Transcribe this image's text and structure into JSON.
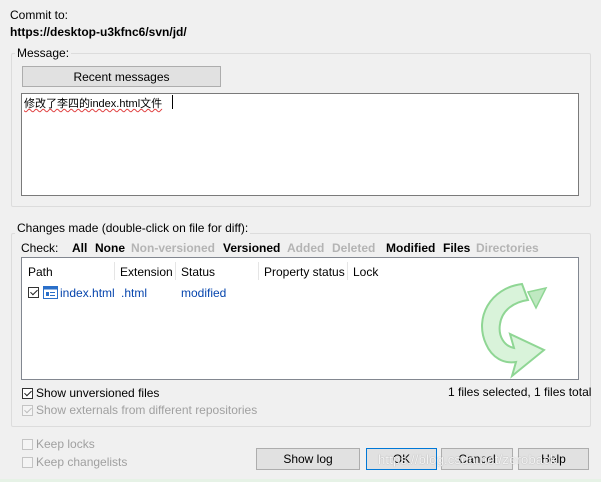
{
  "commit": {
    "label": "Commit to:",
    "url": "https://desktop-u3kfnc6/svn/jd/"
  },
  "message": {
    "group_label": "Message:",
    "recent_button": "Recent messages",
    "text": "修改了李四的index.html文件"
  },
  "changes": {
    "group_label": "Changes made (double-click on file for diff):",
    "check_label": "Check:",
    "filters": [
      {
        "label": "All",
        "enabled": true
      },
      {
        "label": "None",
        "enabled": true
      },
      {
        "label": "Non-versioned",
        "enabled": false
      },
      {
        "label": "Versioned",
        "enabled": true
      },
      {
        "label": "Added",
        "enabled": false
      },
      {
        "label": "Deleted",
        "enabled": false
      },
      {
        "label": "Modified",
        "enabled": true
      },
      {
        "label": "Files",
        "enabled": true
      },
      {
        "label": "Directories",
        "enabled": false
      }
    ],
    "columns": [
      "Path",
      "Extension",
      "Status",
      "Property status",
      "Lock"
    ],
    "rows": [
      {
        "checked": true,
        "path": "index.html",
        "extension": ".html",
        "status": "modified",
        "property_status": "",
        "lock": ""
      }
    ],
    "show_unversioned": {
      "label": "Show unversioned files",
      "checked": true
    },
    "show_externals": {
      "label": "Show externals from different repositories",
      "checked": true,
      "enabled": false
    },
    "summary": "1 files selected, 1 files total"
  },
  "options": {
    "keep_locks": {
      "label": "Keep locks",
      "checked": false,
      "enabled": false
    },
    "keep_changelists": {
      "label": "Keep changelists",
      "checked": false,
      "enabled": false
    }
  },
  "buttons": {
    "show_log": "Show log",
    "ok": "OK",
    "cancel": "Cancel",
    "help": "Help"
  },
  "watermark": "https://blog.csdn.net/zeroback",
  "colors": {
    "link": "#0645ad",
    "window_bg": "#f0f0f0",
    "logo_green": "#3fbf4a"
  }
}
